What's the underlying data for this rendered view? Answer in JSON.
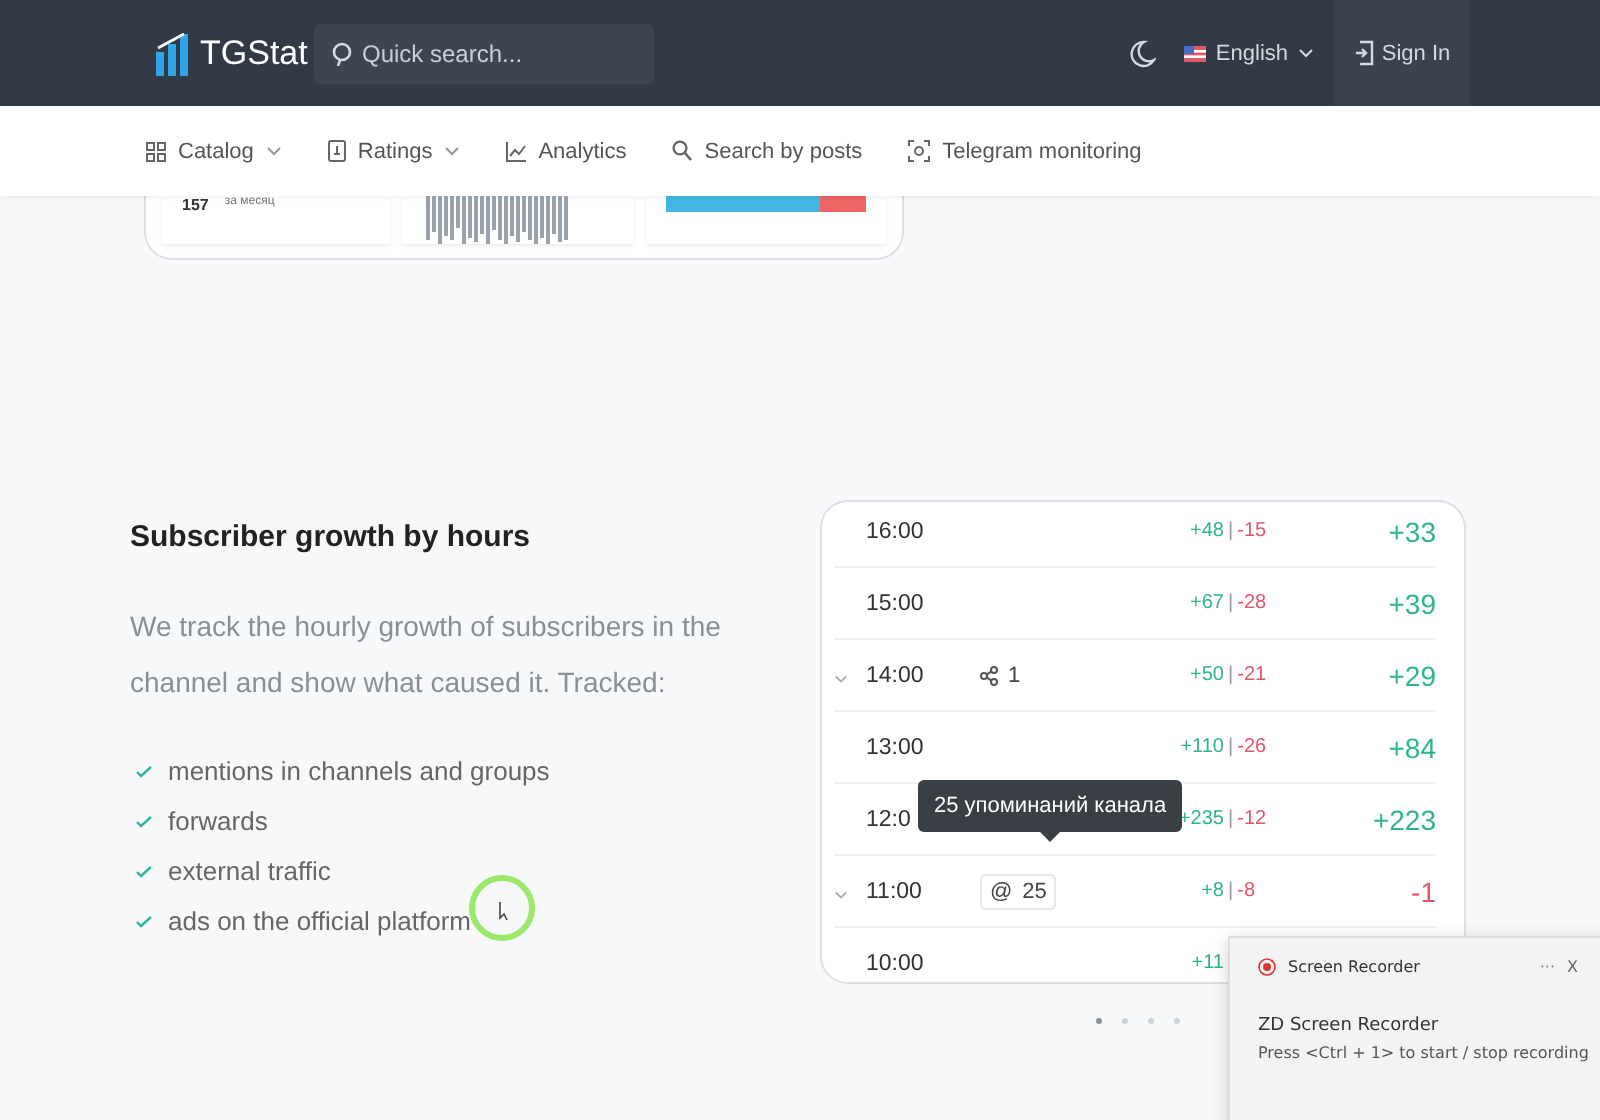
{
  "header": {
    "logo_text": "TGStat",
    "search": {
      "placeholder": "Quick search..."
    },
    "language": "English",
    "sign_in": "Sign In"
  },
  "nav": [
    {
      "kind": "catalog",
      "label": "Catalog",
      "dropdown": true
    },
    {
      "kind": "ratings",
      "label": "Ratings",
      "dropdown": true
    },
    {
      "kind": "analytics",
      "label": "Analytics",
      "dropdown": false
    },
    {
      "kind": "search",
      "label": "Search by posts",
      "dropdown": false
    },
    {
      "kind": "monitoring",
      "label": "Telegram monitoring",
      "dropdown": false
    }
  ],
  "preview_card": {
    "count": "157",
    "period": "за месяц",
    "share_bar": {
      "level": 0.77
    }
  },
  "feature": {
    "title": "Subscriber growth by hours",
    "description": "We track the hourly growth of subscribers in the channel and show what caused it. Tracked:",
    "items": [
      "mentions in channels and groups",
      "forwards",
      "external traffic",
      "ads on the official platform"
    ]
  },
  "hours_table": {
    "rows": [
      {
        "time": "16:00",
        "expandable": false,
        "plus": "+48",
        "separator": "|",
        "minus": "-15",
        "total": "+33",
        "color": "#2fb58a"
      },
      {
        "time": "15:00",
        "expandable": false,
        "plus": "+67",
        "separator": "|",
        "minus": "-28",
        "total": "+39",
        "color": "#2fb58a"
      },
      {
        "time": "14:00",
        "expandable": true,
        "source": {
          "kind": "forward",
          "count": "1"
        },
        "plus": "+50",
        "separator": "|",
        "minus": "-21",
        "total": "+29",
        "color": "#2fb58a"
      },
      {
        "time": "13:00",
        "expandable": false,
        "plus": "+110",
        "separator": "|",
        "minus": "-26",
        "total": "+84",
        "color": "#2fb58a"
      },
      {
        "time": "12:0",
        "expandable": false,
        "plus": "+235",
        "separator": "|",
        "minus": "-12",
        "total": "+223",
        "color": "#2fb58a"
      },
      {
        "time": "11:00",
        "expandable": true,
        "source": {
          "kind": "mention",
          "symbol": "@",
          "count": "25"
        },
        "plus": "+8",
        "separator": "|",
        "minus": "-8",
        "total": "-1",
        "color": "#e2556b"
      },
      {
        "time": "10:00",
        "expandable": false,
        "plus": "+11"
      }
    ],
    "tooltip": "25 упоминаний канала"
  },
  "pagination": [
    {
      "selected": true
    },
    {
      "selected": false
    },
    {
      "selected": false
    },
    {
      "selected": false
    }
  ],
  "notification": {
    "app": "Screen Recorder",
    "more": "···",
    "close": "X",
    "title": "ZD Screen Recorder",
    "message": "Press <Ctrl + 1> to start / stop recording"
  }
}
